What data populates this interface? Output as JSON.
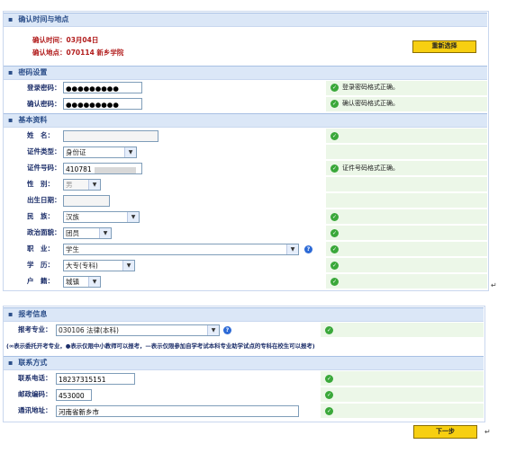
{
  "confirm": {
    "header": "确认时间与地点",
    "time_label": "确认时间：",
    "time_value": "03月04日",
    "place_label": "确认地点：",
    "place_value": "070114  新乡学院",
    "reselect_button": "重新选择"
  },
  "password": {
    "header": "密码设置",
    "login_label": "登录密码：",
    "login_value": "●●●●●●●●●",
    "login_msg": "登录密码格式正确。",
    "confirm_label": "确认密码：",
    "confirm_value": "●●●●●●●●●",
    "confirm_msg": "确认密码格式正确。"
  },
  "basic": {
    "header": "基本资料",
    "name_label": "姓　名：",
    "name_value": "",
    "idtype_label": "证件类型：",
    "idtype_value": "身份证",
    "idnum_label": "证件号码：",
    "idnum_value": "410781",
    "idnum_msg": "证件号码格式正确。",
    "gender_label": "性　别：",
    "gender_value": "男",
    "birth_label": "出生日期：",
    "birth_value": "",
    "ethnic_label": "民　族：",
    "ethnic_value": "汉族",
    "political_label": "政治面貌：",
    "political_value": "团员",
    "job_label": "职　业：",
    "job_value": "学生",
    "edu_label": "学　历：",
    "edu_value": "大专(专科)",
    "hukou_label": "户　籍：",
    "hukou_value": "城镇"
  },
  "exam": {
    "header": "报考信息",
    "major_label": "报考专业：",
    "major_value": "030106 法律(本科)",
    "note": "(∞表示委托开考专业，●表示仅限中小教师可以报考，—表示仅限参加自学考试本科专业助学试点的专科在校生可以报考)"
  },
  "contact": {
    "header": "联系方式",
    "phone_label": "联系电话：",
    "phone_value": "18237315151",
    "zip_label": "邮政编码：",
    "zip_value": "453000",
    "addr_label": "通讯地址：",
    "addr_value": "河南省新乡市"
  },
  "next_button": "下一步",
  "icons": {
    "check": "check-circle-icon",
    "help": "help-icon",
    "return_mark": "↵"
  },
  "colors": {
    "header_bg": "#dbe7f7",
    "ok_green": "#3aa83a",
    "button_yellow": "#f7cf11",
    "row_green": "#ecf7e8"
  }
}
